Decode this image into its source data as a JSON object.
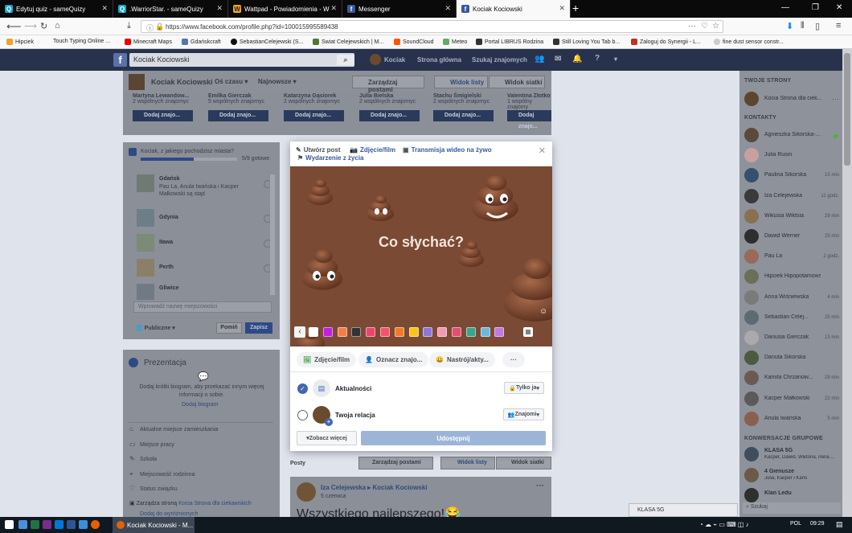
{
  "browser": {
    "tabs": [
      {
        "label": "Edytuj quiz - sameQuizy",
        "icon": "samequizy-icon",
        "color": "#1aa6c7"
      },
      {
        "label": ".WarriorStar. - sameQuizy",
        "icon": "samequizy-icon",
        "color": "#1aa6c7"
      },
      {
        "label": "Wattpad - Powiadomienia - W",
        "icon": "wattpad-icon",
        "color": "#f5a623"
      },
      {
        "label": "Messenger",
        "icon": "facebook-icon",
        "color": "#3b5998"
      },
      {
        "label": "Kociak Kociowski",
        "icon": "facebook-icon",
        "color": "#3b5998"
      }
    ],
    "url": "https://www.facebook.com/profile.php?id=100015995589438",
    "bookmarks": [
      "Hipciek",
      "Touch Typing Online ...",
      "Minecraft Maps",
      "Gdańskcraft",
      "SebastianCelejewski (S...",
      "Swiat Celejewskich | M...",
      "SoundCloud",
      "Meteo",
      "Portal LIBRUS Rodzina",
      "Still Loving You Tab b...",
      "Zaloguj do Synergii - L...",
      "fine dust sensor constr..."
    ]
  },
  "fb": {
    "search_value": "Kociak Kociowski",
    "user": "Kociak",
    "nav_home": "Strona główna",
    "nav_find": "Szukaj znajomych",
    "profile_name": "Kociak Kociowski",
    "timeline_label": "Oś czasu",
    "newest_label": "Najnowsze",
    "manage_posts": "Zarządzaj postami",
    "list_view": "Widok listy",
    "grid_view": "Widok siatki",
    "friends": [
      {
        "name": "Martyna Lewandow...",
        "mutual": "2 wspólnych znajomyc"
      },
      {
        "name": "Emilka Gierczak",
        "mutual": "5 wspólnych znajomyc"
      },
      {
        "name": "Katarzyna Gąsiorek",
        "mutual": "2 wspólnych znajomyc"
      },
      {
        "name": "Julia Bielska",
        "mutual": "2 wspólnych znajomyc"
      },
      {
        "name": "Stachu Śmigielski",
        "mutual": "2 wspólnych znajomyc"
      },
      {
        "name": "Valentina Złotko",
        "mutual": "1 wspólny znajomy"
      }
    ],
    "add_friend": "Dodaj znajo...",
    "quiz": {
      "question": "Kociak, z jakiego pochodzisz miasta?",
      "progress_text": "5/9 gotowe",
      "progress": 0.55,
      "cities": [
        {
          "name": "Gdańsk",
          "sub": "Pau La, Anula Iwańska i Kacper Małkowski są stąd"
        },
        {
          "name": "Gdynia",
          "sub": ""
        },
        {
          "name": "Iława",
          "sub": ""
        },
        {
          "name": "Perth",
          "sub": ""
        },
        {
          "name": "Gliwice",
          "sub": ""
        }
      ],
      "input_placeholder": "Wprowadź nazwę miejscowości",
      "privacy": "Publiczne",
      "skip": "Pomiń",
      "save": "Zapisz"
    },
    "presentation": {
      "title": "Prezentacja",
      "text": "Dodaj krótki biogram, aby przekazać innym więcej informacji o sobie.",
      "add_bio": "Dodaj biogram",
      "items": [
        "Aktualne miejsce zamieszkania",
        "Miejsce pracy",
        "Szkoła",
        "Miejscowość rodzinna",
        "Status związku"
      ],
      "page_admin_prefix": "Zarządza stroną",
      "page_admin_link": "Kocia Strona dla ciekawskich",
      "add_fav": "Dodaj do wyróżnionych"
    },
    "posts_label": "Posty",
    "post": {
      "author": "Iza Celejewska",
      "target": "Kociak Kociowski",
      "date": "5 czerwca",
      "text": "Wszystkiego najlepszego!😂"
    }
  },
  "composer": {
    "tab_post": "Utwórz post",
    "tab_photo": "Zdjęcie/film",
    "tab_live": "Transmisja wideo na żywo",
    "tab_event": "Wydarzenie z życia",
    "prompt": "Co słychać?",
    "chip_photo": "Zdjęcie/film",
    "chip_tag": "Oznacz znajo...",
    "chip_mood": "Nastrój/akty...",
    "feed_label": "Aktualności",
    "feed_privacy": "Tylko ja",
    "story_label": "Twoja relacja",
    "story_privacy": "Znajomi",
    "see_more": "Zobacz więcej",
    "share": "Udostępnij",
    "swatches": [
      "#ffffff",
      "#c21fe0",
      "#f07e4b",
      "#333333",
      "#e8476b",
      "#f5536b",
      "#f07a2a",
      "#f5c518",
      "#8a78d8",
      "#f09ab0",
      "#e34f70",
      "#3da48a",
      "#6fb7d8",
      "#c178e0"
    ]
  },
  "right": {
    "pages_title": "TWOJE STRONY",
    "page_name": "Kocia Strona dla ciek...",
    "contacts_title": "KONTAKTY",
    "contacts": [
      {
        "name": "Agnieszka Sikorska-...",
        "time": ""
      },
      {
        "name": "Julia Rusin",
        "time": ""
      },
      {
        "name": "Paulina Sikorska",
        "time": "15 min"
      },
      {
        "name": "Iza Celejewska",
        "time": "11 godz."
      },
      {
        "name": "Wikusia Wiktsia",
        "time": "29 min"
      },
      {
        "name": "Dawid Werner",
        "time": "25 min"
      },
      {
        "name": "Pau La",
        "time": "2 godz."
      },
      {
        "name": "Hipciek Hipopotamowski",
        "time": ""
      },
      {
        "name": "Anna Wiśniewska",
        "time": "4 min"
      },
      {
        "name": "Sebastian Celej...",
        "time": "25 min"
      },
      {
        "name": "Danusia Gierczak",
        "time": "13 min"
      },
      {
        "name": "Danuta Sikorska",
        "time": ""
      },
      {
        "name": "Kamila Chrzanow...",
        "time": "29 min"
      },
      {
        "name": "Kacper Małkowski",
        "time": "22 min"
      },
      {
        "name": "Anula Iwańska",
        "time": "5 min"
      }
    ],
    "groups_title": "KONWERSACJE GRUPOWE",
    "groups": [
      {
        "name": "KLASA 5G",
        "sub": "Kacper, Dawid, Wiktoria, Irena ..."
      },
      {
        "name": "4 Gienusze",
        "sub": "Julia, Kacper i Kami"
      },
      {
        "name": "Klan Ledu",
        "sub": ""
      }
    ],
    "search_placeholder": "Szukaj",
    "chat_tab": "KLASA 5G"
  },
  "taskbar": {
    "active_app": "Kociak Kociowski - M...",
    "language": "POL",
    "time": "09:29"
  }
}
